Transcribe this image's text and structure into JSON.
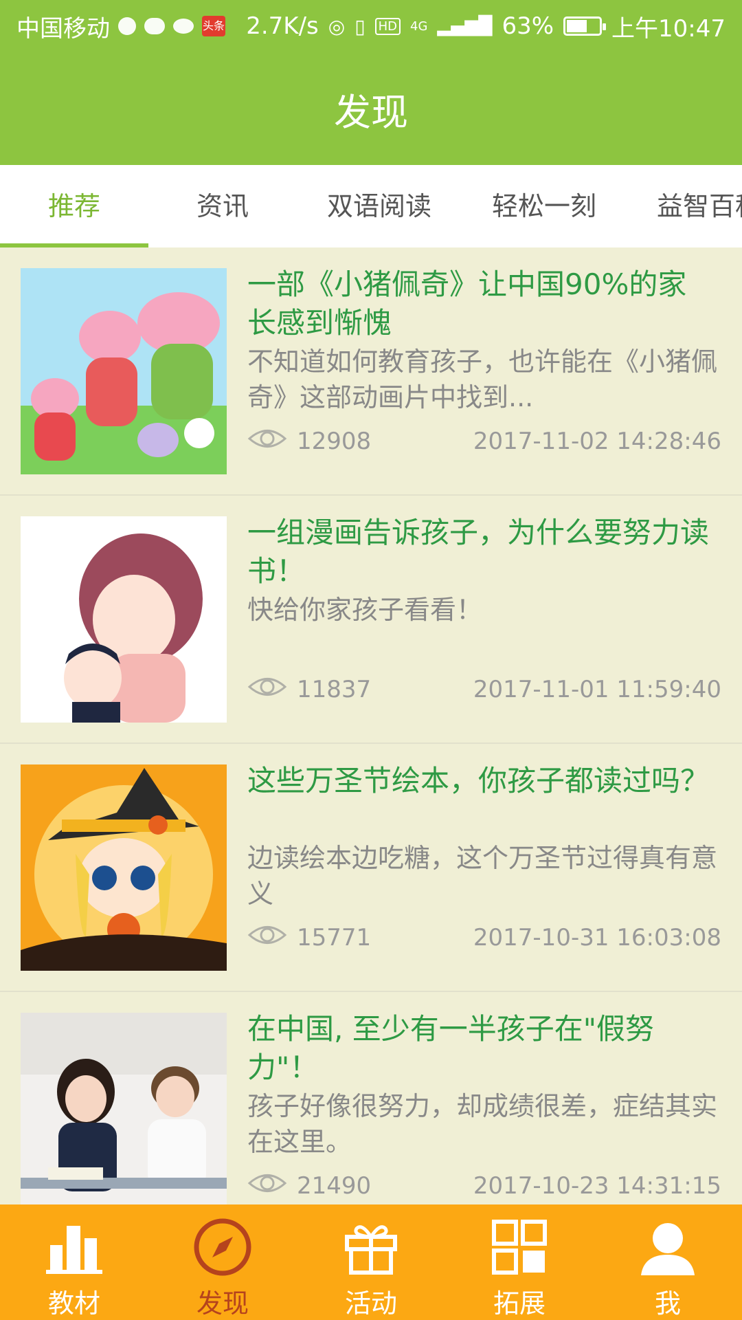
{
  "status_bar": {
    "carrier": "中国移动",
    "toutiao_badge": "头条",
    "speed": "2.7K/s",
    "hd": "HD",
    "network": "4G",
    "battery": "63%",
    "battery_level": 0.63,
    "time": "上午10:47"
  },
  "header": {
    "title": "发现"
  },
  "tabs": [
    {
      "label": "推荐",
      "active": true
    },
    {
      "label": "资讯"
    },
    {
      "label": "双语阅读"
    },
    {
      "label": "轻松一刻"
    },
    {
      "label": "益智百科"
    }
  ],
  "articles": [
    {
      "title": "一部《小猪佩奇》让中国90%的家长感到惭愧",
      "summary": "不知道如何教育孩子，也许能在《小猪佩奇》这部动画片中找到...",
      "views": "12908",
      "date": "2017-11-02 14:28:46"
    },
    {
      "title": "一组漫画告诉孩子，为什么要努力读书！",
      "summary": "快给你家孩子看看！",
      "views": "11837",
      "date": "2017-11-01 11:59:40"
    },
    {
      "title": "这些万圣节绘本，你孩子都读过吗？",
      "summary": "边读绘本边吃糖，这个万圣节过得真有意义",
      "views": "15771",
      "date": "2017-10-31 16:03:08"
    },
    {
      "title": "在中国, 至少有一半孩子在\"假努力\"！",
      "summary": "孩子好像很努力，却成绩很差，症结其实在这里。",
      "views": "21490",
      "date": "2017-10-23 14:31:15"
    }
  ],
  "bottom_nav": [
    {
      "label": "教材",
      "icon": "bar-chart-icon"
    },
    {
      "label": "发现",
      "icon": "compass-icon",
      "active": true
    },
    {
      "label": "活动",
      "icon": "gift-icon"
    },
    {
      "label": "拓展",
      "icon": "grid-icon"
    },
    {
      "label": "我",
      "icon": "person-icon"
    }
  ],
  "colors": {
    "header_green": "#8dc540",
    "title_green": "#2e9a44",
    "list_bg": "#f0efd5",
    "tabbar_orange": "#fca813",
    "active_nav": "#b5431d"
  }
}
